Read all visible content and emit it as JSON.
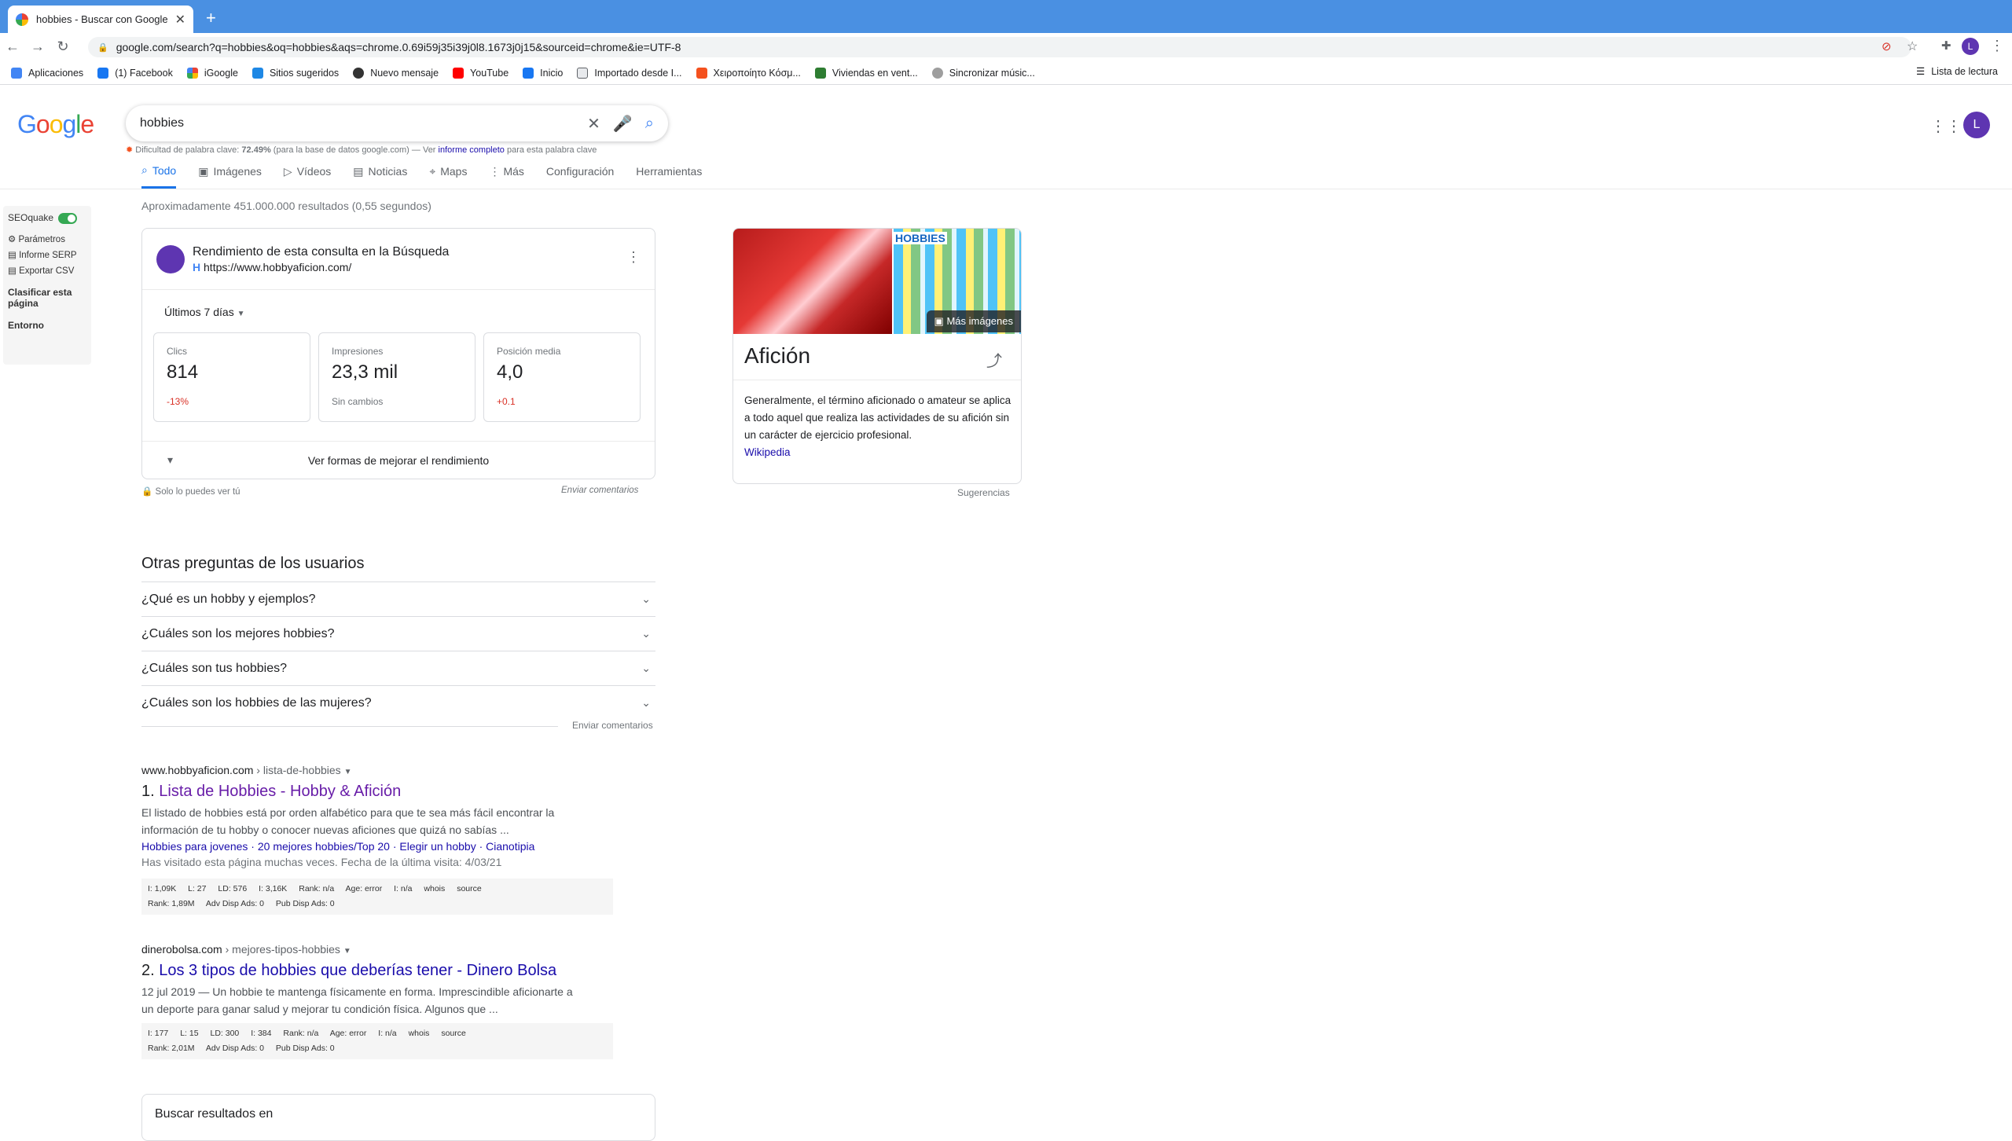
{
  "browser": {
    "tab_title": "hobbies - Buscar con Google",
    "new_tab": "+",
    "url": "google.com/search?q=hobbies&oq=hobbies&aqs=chrome.0.69i59j35i39j0l8.1673j0j15&sourceid=chrome&ie=UTF-8",
    "bookmarks": [
      "Aplicaciones",
      "(1) Facebook",
      "iGoogle",
      "Sitios sugeridos",
      "Nuevo mensaje",
      "YouTube",
      "Inicio",
      "Importado desde I...",
      "Χειροποίητο Κόσμ...",
      "Viviendas en vent...",
      "Sincronizar músic..."
    ],
    "reading_list": "Lista de lectura",
    "profile_initial": "L"
  },
  "google": {
    "logo": "Google",
    "query": "hobbies",
    "kw_difficulty_prefix": "Dificultad de palabra clave:",
    "kw_difficulty_value": "72.49%",
    "kw_difficulty_mid": "(para la base de datos google.com) — Ver",
    "kw_difficulty_link": "informe completo",
    "kw_difficulty_suffix": "para esta palabra clave",
    "tabs": [
      "Todo",
      "Imágenes",
      "Vídeos",
      "Noticias",
      "Maps",
      "Más",
      "Configuración",
      "Herramientas"
    ],
    "stats": "Aproximadamente 451.000.000 resultados (0,55 segundos)",
    "avatar": "L"
  },
  "seoquake": {
    "title": "SEOquake",
    "items": [
      "Parámetros",
      "Informe SERP",
      "Exportar CSV"
    ],
    "classify": "Clasificar esta página",
    "environment": "Entorno"
  },
  "gsc": {
    "title": "Rendimiento de esta consulta en la Búsqueda",
    "url": "https://www.hobbyaficion.com/",
    "period": "Últimos 7 días",
    "metrics": [
      {
        "label": "Clics",
        "value": "814",
        "change": "-13%"
      },
      {
        "label": "Impresiones",
        "value": "23,3 mil",
        "change": "Sin cambios"
      },
      {
        "label": "Posición media",
        "value": "4,0",
        "change": "+0.1"
      }
    ],
    "footer": "Ver formas de mejorar el rendimiento",
    "private": "Solo lo puedes ver tú",
    "feedback": "Enviar comentarios"
  },
  "knowledge_panel": {
    "image_label": "HOBBIES",
    "more_images": "Más imágenes",
    "title": "Afición",
    "description": "Generalmente, el término aficionado o amateur se aplica a todo aquel que realiza las actividades de su afición sin un carácter de ejercicio profesional.",
    "source": "Wikipedia",
    "suggestions": "Sugerencias"
  },
  "paa": {
    "title": "Otras preguntas de los usuarios",
    "questions": [
      "¿Qué es un hobby y ejemplos?",
      "¿Cuáles son los mejores hobbies?",
      "¿Cuáles son tus hobbies?",
      "¿Cuáles son los hobbies de las mujeres?"
    ],
    "feedback": "Enviar comentarios"
  },
  "results": [
    {
      "domain": "www.hobbyaficion.com",
      "path": "› lista-de-hobbies",
      "title_num": "1.",
      "title": "Lista de Hobbies - Hobby & Afición",
      "snippet": "El listado de hobbies está por orden alfabético para que te sea más fácil encontrar la información de tu hobby o conocer nuevas aficiones que quizá no sabías ...",
      "sitelinks": "Hobbies para jovenes · 20 mejores hobbies/Top 20 · Elegir un hobby · Cianotipia",
      "visited": "Has visitado esta página muchas veces. Fecha de la última visita: 4/03/21",
      "sq_row1": [
        "I: 1,09K",
        "L: 27",
        "LD: 576",
        "I: 3,16K",
        "Rank: n/a",
        "Age: error",
        "I: n/a",
        "whois",
        "source"
      ],
      "sq_row2": [
        "Rank: 1,89M",
        "Adv Disp Ads: 0",
        "Pub Disp Ads: 0"
      ]
    },
    {
      "domain": "dinerobolsa.com",
      "path": "› mejores-tipos-hobbies",
      "title_num": "2.",
      "title": "Los 3 tipos de hobbies que deberías tener - Dinero Bolsa",
      "snippet": "12 jul 2019 — Un hobbie te mantenga físicamente en forma. Imprescindible aficionarte a un deporte para ganar salud y mejorar tu condición física. Algunos que ...",
      "sq_row1": [
        "I: 177",
        "L: 15",
        "LD: 300",
        "I: 384",
        "Rank: n/a",
        "Age: error",
        "I: n/a",
        "whois",
        "source"
      ],
      "sq_row2": [
        "Rank: 2,01M",
        "Adv Disp Ads: 0",
        "Pub Disp Ads: 0"
      ]
    }
  ],
  "search_in": "Buscar resultados en",
  "colors": {
    "accent": "#1a73e8",
    "link": "#1a0dab",
    "visited": "#681da8",
    "negative": "#d93025",
    "tabstrip": "#4a90e2"
  }
}
